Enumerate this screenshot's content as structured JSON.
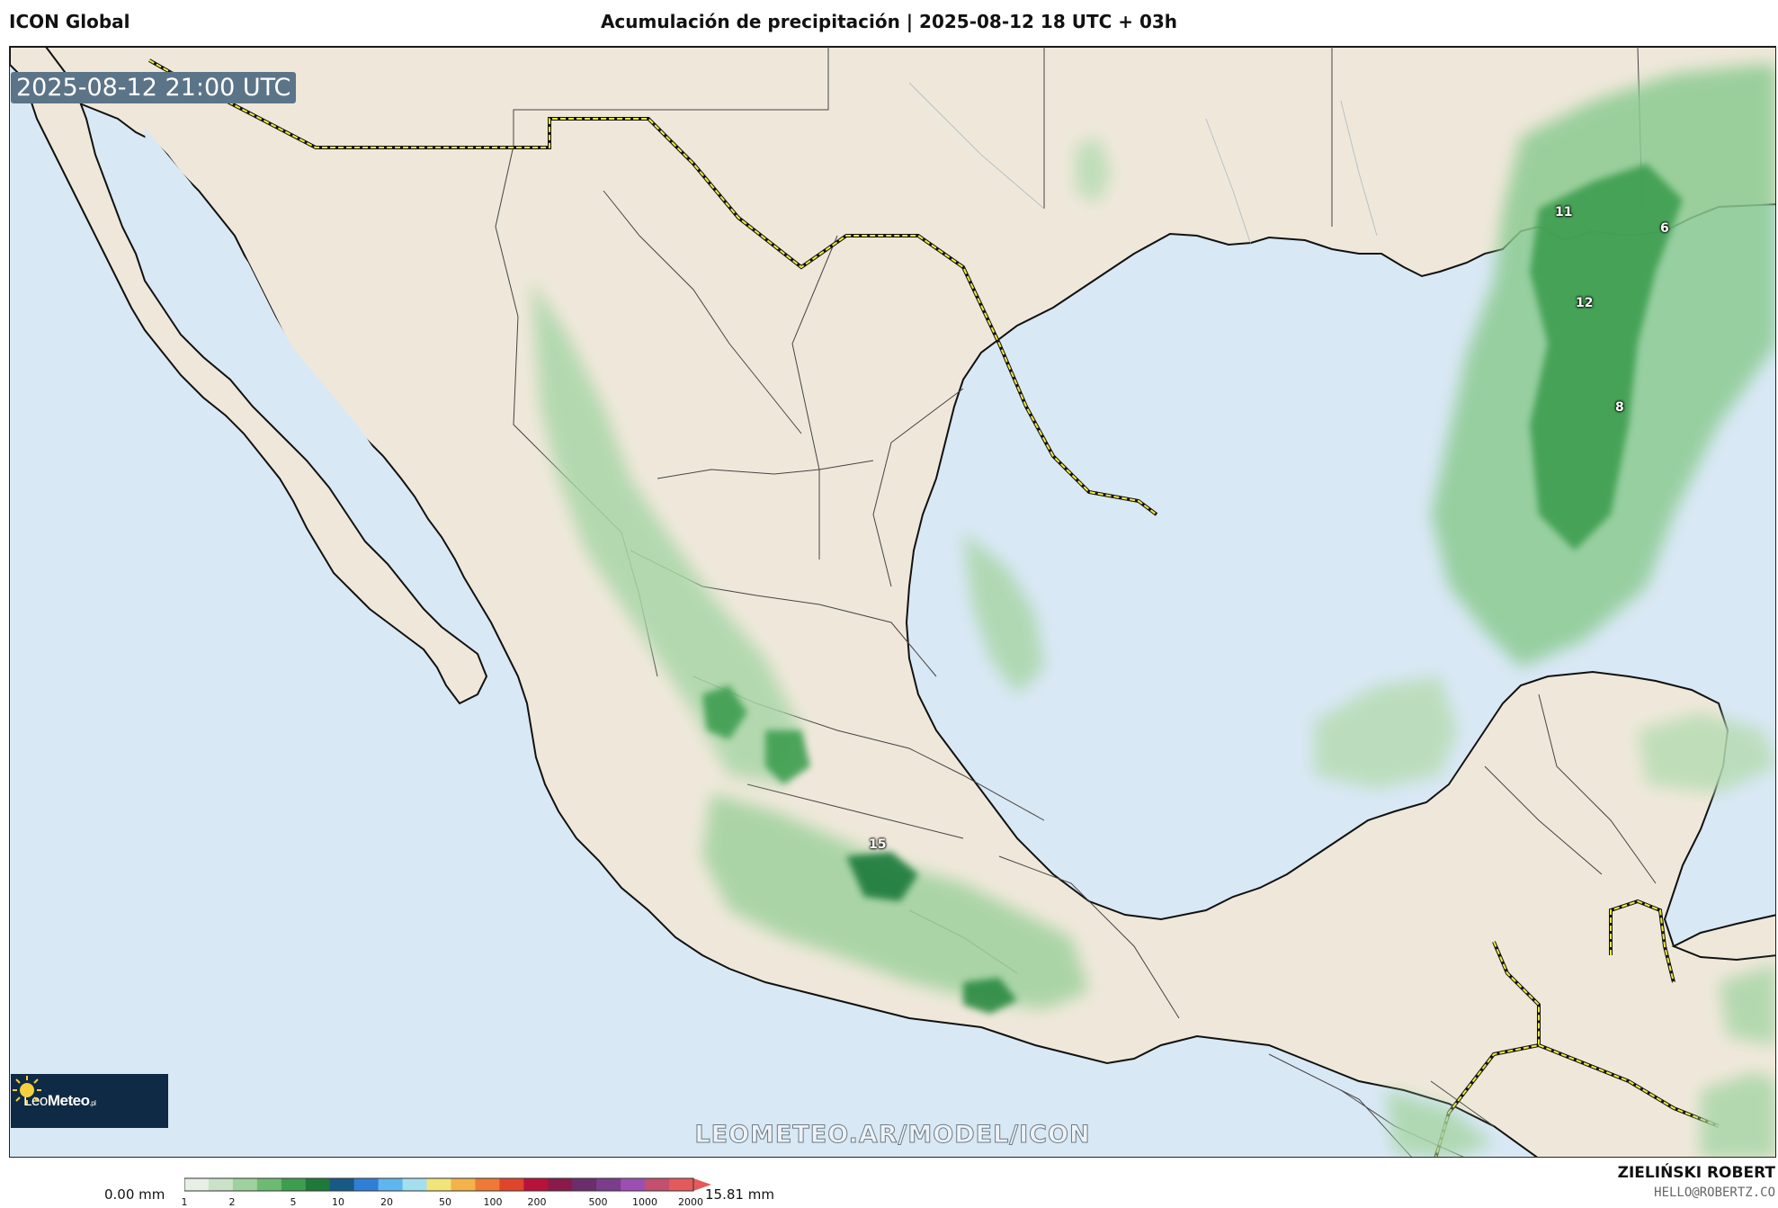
{
  "header": {
    "model": "ICON Global",
    "title": "Acumulación de precipitación | 2025-08-12 18 UTC + 03h"
  },
  "map": {
    "valid_time": "2025-08-12 21:00 UTC",
    "watermark": "LEOMETEO.AR/MODEL/ICON",
    "logo": {
      "prefix": "Leo",
      "bold": "Meteo",
      "suffix": ".pl"
    },
    "ocean_color": "#d9e8f5",
    "land_color": "#efe8da",
    "precip_labels": [
      {
        "value": "11",
        "area": "Louisiana coast"
      },
      {
        "value": "6",
        "area": "Gulf coast east"
      },
      {
        "value": "12",
        "area": "Gulf of Mexico north"
      },
      {
        "value": "8",
        "area": "Gulf of Mexico east"
      },
      {
        "value": "15",
        "area": "Michoacán / Guerrero"
      }
    ]
  },
  "colorbar": {
    "min_label": "0.00 mm",
    "max_label": "15.81 mm",
    "ticks": [
      "1",
      "2",
      "5",
      "10",
      "20",
      "50",
      "100",
      "200",
      "500",
      "1000",
      "2000"
    ],
    "colors": [
      "#e8efe6",
      "#c9e2c8",
      "#9fd19e",
      "#6dbb72",
      "#3e9e4f",
      "#1f7a3a",
      "#175a86",
      "#2f7fd6",
      "#5fb6ee",
      "#a4dff0",
      "#f1e57a",
      "#f4b24a",
      "#ef7a36",
      "#e0452c",
      "#b8123a",
      "#8a1a4a",
      "#6b2d6b",
      "#7a3d8c",
      "#9c4fb0",
      "#c44f6e",
      "#e45a5a"
    ]
  },
  "footer": {
    "author": "ZIELIŃSKI ROBERT",
    "email": "HELLO@ROBERTZ.CO"
  }
}
